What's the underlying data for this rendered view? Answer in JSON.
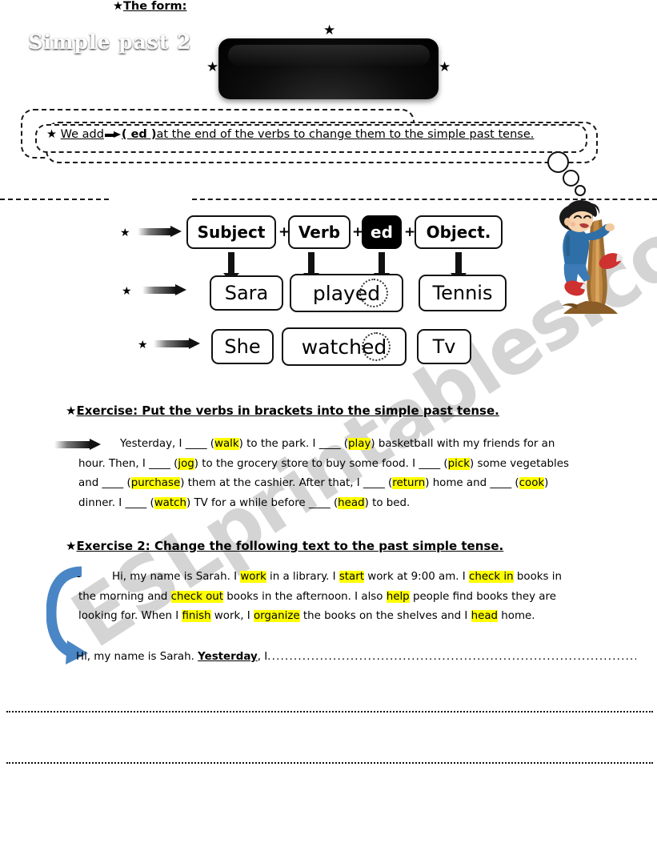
{
  "title": {
    "text": "Simple past  2",
    "star": "★"
  },
  "rule_bubble": {
    "star": "★",
    "part1": "We add",
    "arrow_icon": "right-arrow-icon",
    "part2": "( ed )",
    "part3": "at the end of the verbs to change them to the simple past tense."
  },
  "form_section": {
    "star": "★",
    "label": "The form:"
  },
  "diagram": {
    "row1": {
      "star": "★",
      "cells": [
        "Subject",
        "Verb",
        "ed",
        "Object."
      ],
      "plus": "+"
    },
    "row2": {
      "star": "★",
      "cells": [
        "Sara",
        "played",
        "Tennis"
      ],
      "circled": "ed"
    },
    "row3": {
      "star": "★",
      "cells": [
        "She",
        "watched",
        "Tv"
      ],
      "circled": "ed"
    }
  },
  "exercise1": {
    "star": "★",
    "heading": "Exercise: Put the verbs in brackets into the simple past tense.",
    "arrow_icon": "right-arrow-icon",
    "segments": [
      {
        "t": "Yesterday, I ",
        "s": "plain"
      },
      {
        "t": "____",
        "s": "blank"
      },
      {
        "t": " (",
        "s": "plain"
      },
      {
        "t": "walk",
        "s": "hl"
      },
      {
        "t": ") to the park. I ",
        "s": "plain"
      },
      {
        "t": "____",
        "s": "blank"
      },
      {
        "t": " (",
        "s": "plain"
      },
      {
        "t": "play",
        "s": "hl"
      },
      {
        "t": ") basketball with my friends for an hour. Then, I ",
        "s": "plain"
      },
      {
        "t": "____",
        "s": "blank"
      },
      {
        "t": " (",
        "s": "plain"
      },
      {
        "t": "jog",
        "s": "hl"
      },
      {
        "t": ") to the grocery store to buy some food. I ",
        "s": "plain"
      },
      {
        "t": "____",
        "s": "blank"
      },
      {
        "t": " (",
        "s": "plain"
      },
      {
        "t": "pick",
        "s": "hl"
      },
      {
        "t": ") some vegetables and ",
        "s": "plain"
      },
      {
        "t": "____",
        "s": "blank"
      },
      {
        "t": " (",
        "s": "plain"
      },
      {
        "t": "purchase",
        "s": "hl"
      },
      {
        "t": ") them at the cashier. After that, I ",
        "s": "plain"
      },
      {
        "t": "____",
        "s": "blank"
      },
      {
        "t": " (",
        "s": "plain"
      },
      {
        "t": "return",
        "s": "hl"
      },
      {
        "t": ") home and ",
        "s": "plain"
      },
      {
        "t": "____",
        "s": "blank"
      },
      {
        "t": " (",
        "s": "plain"
      },
      {
        "t": "cook",
        "s": "hl"
      },
      {
        "t": ") dinner. I ",
        "s": "plain"
      },
      {
        "t": "____",
        "s": "blank"
      },
      {
        "t": " (",
        "s": "plain"
      },
      {
        "t": "watch",
        "s": "hl"
      },
      {
        "t": ") TV for a while before ",
        "s": "plain"
      },
      {
        "t": "____",
        "s": "blank"
      },
      {
        "t": " (",
        "s": "plain"
      },
      {
        "t": "head",
        "s": "hl"
      },
      {
        "t": ") to bed.",
        "s": "plain"
      }
    ]
  },
  "exercise2": {
    "star": "★",
    "heading": "Exercise 2: Change the following text to the past simple tense.",
    "dash": "-",
    "segments": [
      {
        "t": "Hi, my name is Sarah. I ",
        "s": "plain"
      },
      {
        "t": "work",
        "s": "hl"
      },
      {
        "t": " in a library. I ",
        "s": "plain"
      },
      {
        "t": "start",
        "s": "hl"
      },
      {
        "t": " work at 9:00 am. I ",
        "s": "plain"
      },
      {
        "t": "check in",
        "s": "hl"
      },
      {
        "t": " books in the morning and ",
        "s": "plain"
      },
      {
        "t": "check out",
        "s": "hl"
      },
      {
        "t": " books in the afternoon. I also ",
        "s": "plain"
      },
      {
        "t": "help",
        "s": "hl"
      },
      {
        "t": " people find books they are looking for. When I ",
        "s": "plain"
      },
      {
        "t": "finish",
        "s": "hl"
      },
      {
        "t": " work, I ",
        "s": "plain"
      },
      {
        "t": "organize",
        "s": "hl"
      },
      {
        "t": " the books on the shelves and I ",
        "s": "plain"
      },
      {
        "t": "head",
        "s": "hl"
      },
      {
        "t": " home.",
        "s": "plain"
      }
    ]
  },
  "answer": {
    "prefix": "Hi, my name is Sarah. ",
    "underlined": "Yesterday",
    "suffix": ", I",
    "dots": "..................................................................................................................................................."
  },
  "watermark": {
    "text": "ESLprintables.com"
  },
  "colors": {
    "highlight": "#ffff00",
    "ink": "#000000",
    "blue_arrow": "#4a86c5",
    "watermark": "#c9c9c9"
  }
}
